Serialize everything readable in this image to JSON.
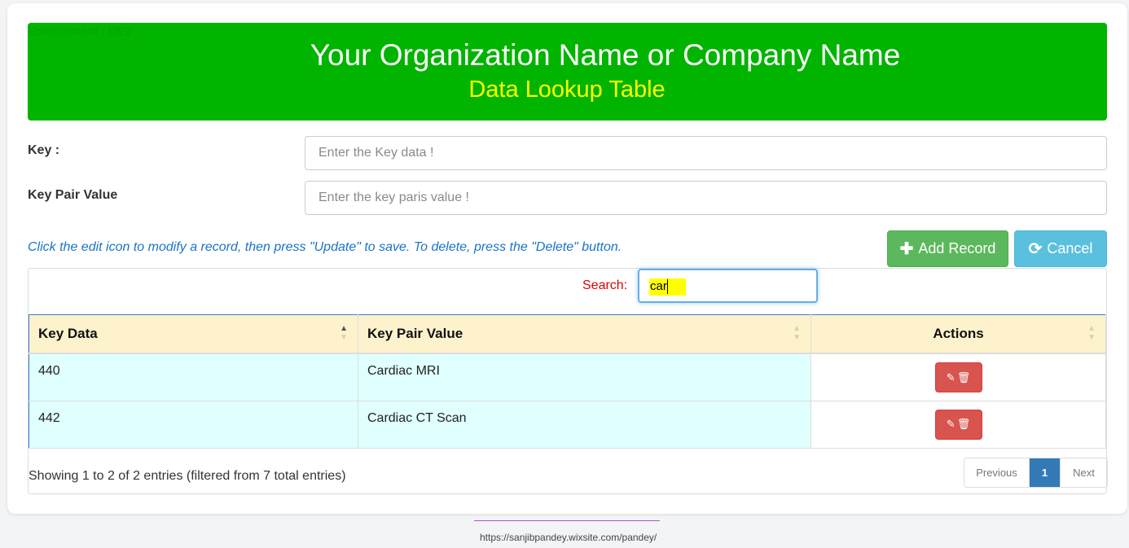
{
  "header": {
    "environment": "Environment : DEV",
    "org_name": "Your Organization Name or Company Name",
    "subtitle": "Data Lookup Table",
    "banner_color": "#00b400",
    "subtitle_color": "#ffff00"
  },
  "form": {
    "key_label": "Key :",
    "key_placeholder": "Enter the Key data !",
    "value_label": "Key Pair Value",
    "value_placeholder": "Enter the key paris value !"
  },
  "hint": "Click the edit icon to modify a record, then press \"Update\" to save. To delete, press the \"Delete\" button.",
  "buttons": {
    "add_icon": "plus-icon",
    "add_label": "Add Record",
    "cancel_icon": "refresh-icon",
    "cancel_label": "Cancel"
  },
  "search": {
    "label": "Search:",
    "value": "car"
  },
  "table": {
    "columns": [
      "Key Data",
      "Key Pair Value",
      "Actions"
    ],
    "rows": [
      {
        "key": "440",
        "value": "Cardiac MRI",
        "actions": [
          "edit-icon",
          "trash-icon"
        ]
      },
      {
        "key": "442",
        "value": "Cardiac CT Scan",
        "actions": [
          "edit-icon",
          "trash-icon"
        ]
      }
    ]
  },
  "info": "Showing 1 to 2 of 2 entries (filtered from 7 total entries)",
  "pagination": {
    "previous": "Previous",
    "current": "1",
    "next": "Next"
  },
  "footer": {
    "link": "https://sanjibpandey.wixsite.com/pandey/"
  }
}
